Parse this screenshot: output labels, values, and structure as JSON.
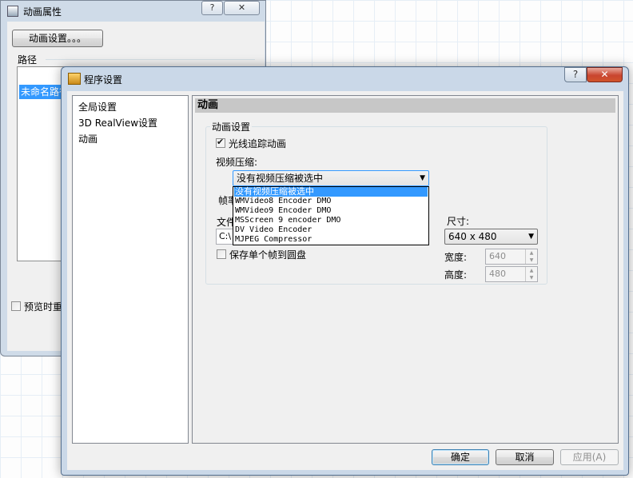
{
  "back_window": {
    "title": "动画属性",
    "help_label": "?",
    "close_label": "✕",
    "settings_button": "动画设置。。。",
    "path_label": "路径",
    "selected_item": "未命名路径",
    "preview_label": "预览时重"
  },
  "front_window": {
    "title": "程序设置",
    "help_label": "?",
    "close_label": "✕",
    "tree": [
      "全局设置",
      "3D RealView设置",
      "动画"
    ],
    "panel_title": "动画",
    "group_title": "动画设置",
    "raytrace_label": "光线追踪动画",
    "raytrace_checked": true,
    "video_compression_label": "视频压缩:",
    "video_compression_value": "没有视频压缩被选中",
    "video_options": [
      "没有视频压缩被选中",
      "WMVideo8 Encoder DMO",
      "WMVideo9 Encoder DMO",
      "MSScreen 9 encoder DMO",
      "DV Video Encoder",
      "MJPEG Compressor"
    ],
    "frame_rate_label": "帧率",
    "file_label": "文件",
    "file_value": "C:\\",
    "save_frame_label": "保存单个帧到圆盘",
    "save_frame_checked": false,
    "size_label": "尺寸:",
    "size_value": "640 x 480",
    "width_label": "宽度:",
    "width_value": "640",
    "height_label": "高度:",
    "height_value": "480",
    "ok_button": "确定",
    "cancel_button": "取消",
    "apply_button": "应用(A)"
  }
}
